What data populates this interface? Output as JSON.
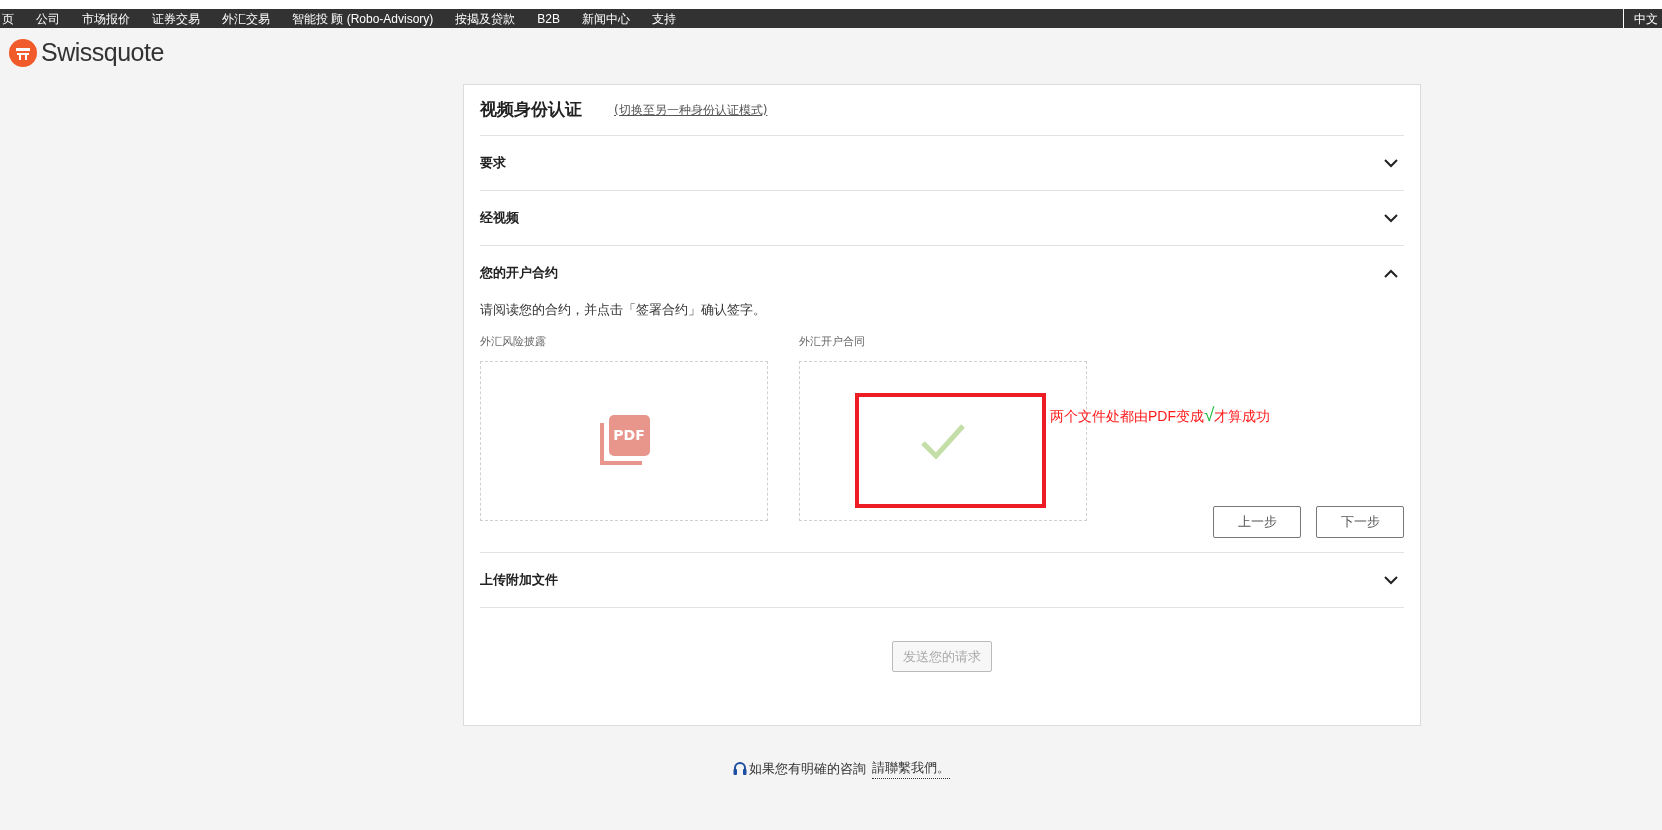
{
  "nav": {
    "items": [
      "页",
      "公司",
      "市场报价",
      "证券交易",
      "外汇交易",
      "智能投 顾 (Robo-Advisory)",
      "按揭及贷款",
      "B2B",
      "新闻中心",
      "支持"
    ],
    "language": "中文"
  },
  "logo": {
    "text": "Swissquote"
  },
  "card": {
    "title": "视频身份认证",
    "switch_link": "(切换至另一种身份认证模式)",
    "sections": [
      {
        "title": "要求",
        "expanded": false
      },
      {
        "title": "经视频",
        "expanded": false
      },
      {
        "title": "您的开户合约",
        "expanded": true,
        "instruction": "请阅读您的合约，并点击「签署合约」确认签字。",
        "documents": [
          {
            "label": "外汇风险披露",
            "kind": "pdf",
            "icon_text": "PDF"
          },
          {
            "label": "外汇开户合同",
            "kind": "signed"
          }
        ],
        "buttons": [
          "上一步",
          "下一步"
        ]
      },
      {
        "title": "上传附加文件",
        "expanded": false
      }
    ],
    "submit": {
      "label": "发送您的请求",
      "disabled": true
    }
  },
  "footer": {
    "text": "如果您有明確的咨詢",
    "link": "請聯繫我們。"
  },
  "annotation": {
    "parts": [
      {
        "text": "两个文件处都由PDF变成",
        "color": "#ff1a1a"
      },
      {
        "text": "√",
        "color": "#22bb44"
      },
      {
        "text": "才算成功",
        "color": "#ff1a1a"
      }
    ]
  }
}
